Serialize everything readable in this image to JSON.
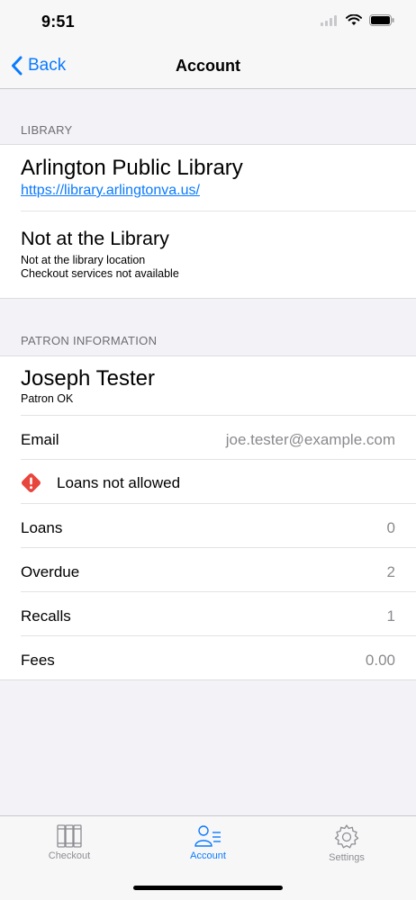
{
  "status_bar": {
    "time": "9:51"
  },
  "nav": {
    "back_label": "Back",
    "title": "Account"
  },
  "library_section": {
    "header": "LIBRARY",
    "name": "Arlington Public Library",
    "url": "https://library.arlingtonva.us/",
    "location_title": "Not at the Library",
    "location_line1": "Not at the library location",
    "location_line2": "Checkout services not available"
  },
  "patron_section": {
    "header": "PATRON INFORMATION",
    "name": "Joseph Tester",
    "status": "Patron OK",
    "email_label": "Email",
    "email_value": "joe.tester@example.com",
    "alert_text": "Loans not allowed",
    "alert_color": "#e8453c",
    "rows": [
      {
        "label": "Loans",
        "value": "0"
      },
      {
        "label": "Overdue",
        "value": "2"
      },
      {
        "label": "Recalls",
        "value": "1"
      },
      {
        "label": "Fees",
        "value": "0.00"
      }
    ]
  },
  "tab_bar": {
    "tabs": [
      {
        "label": "Checkout",
        "icon": "books-icon",
        "active": false
      },
      {
        "label": "Account",
        "icon": "person-list-icon",
        "active": true
      },
      {
        "label": "Settings",
        "icon": "gear-icon",
        "active": false
      }
    ],
    "active_color": "#0a7aff",
    "inactive_color": "#8e8e93"
  }
}
